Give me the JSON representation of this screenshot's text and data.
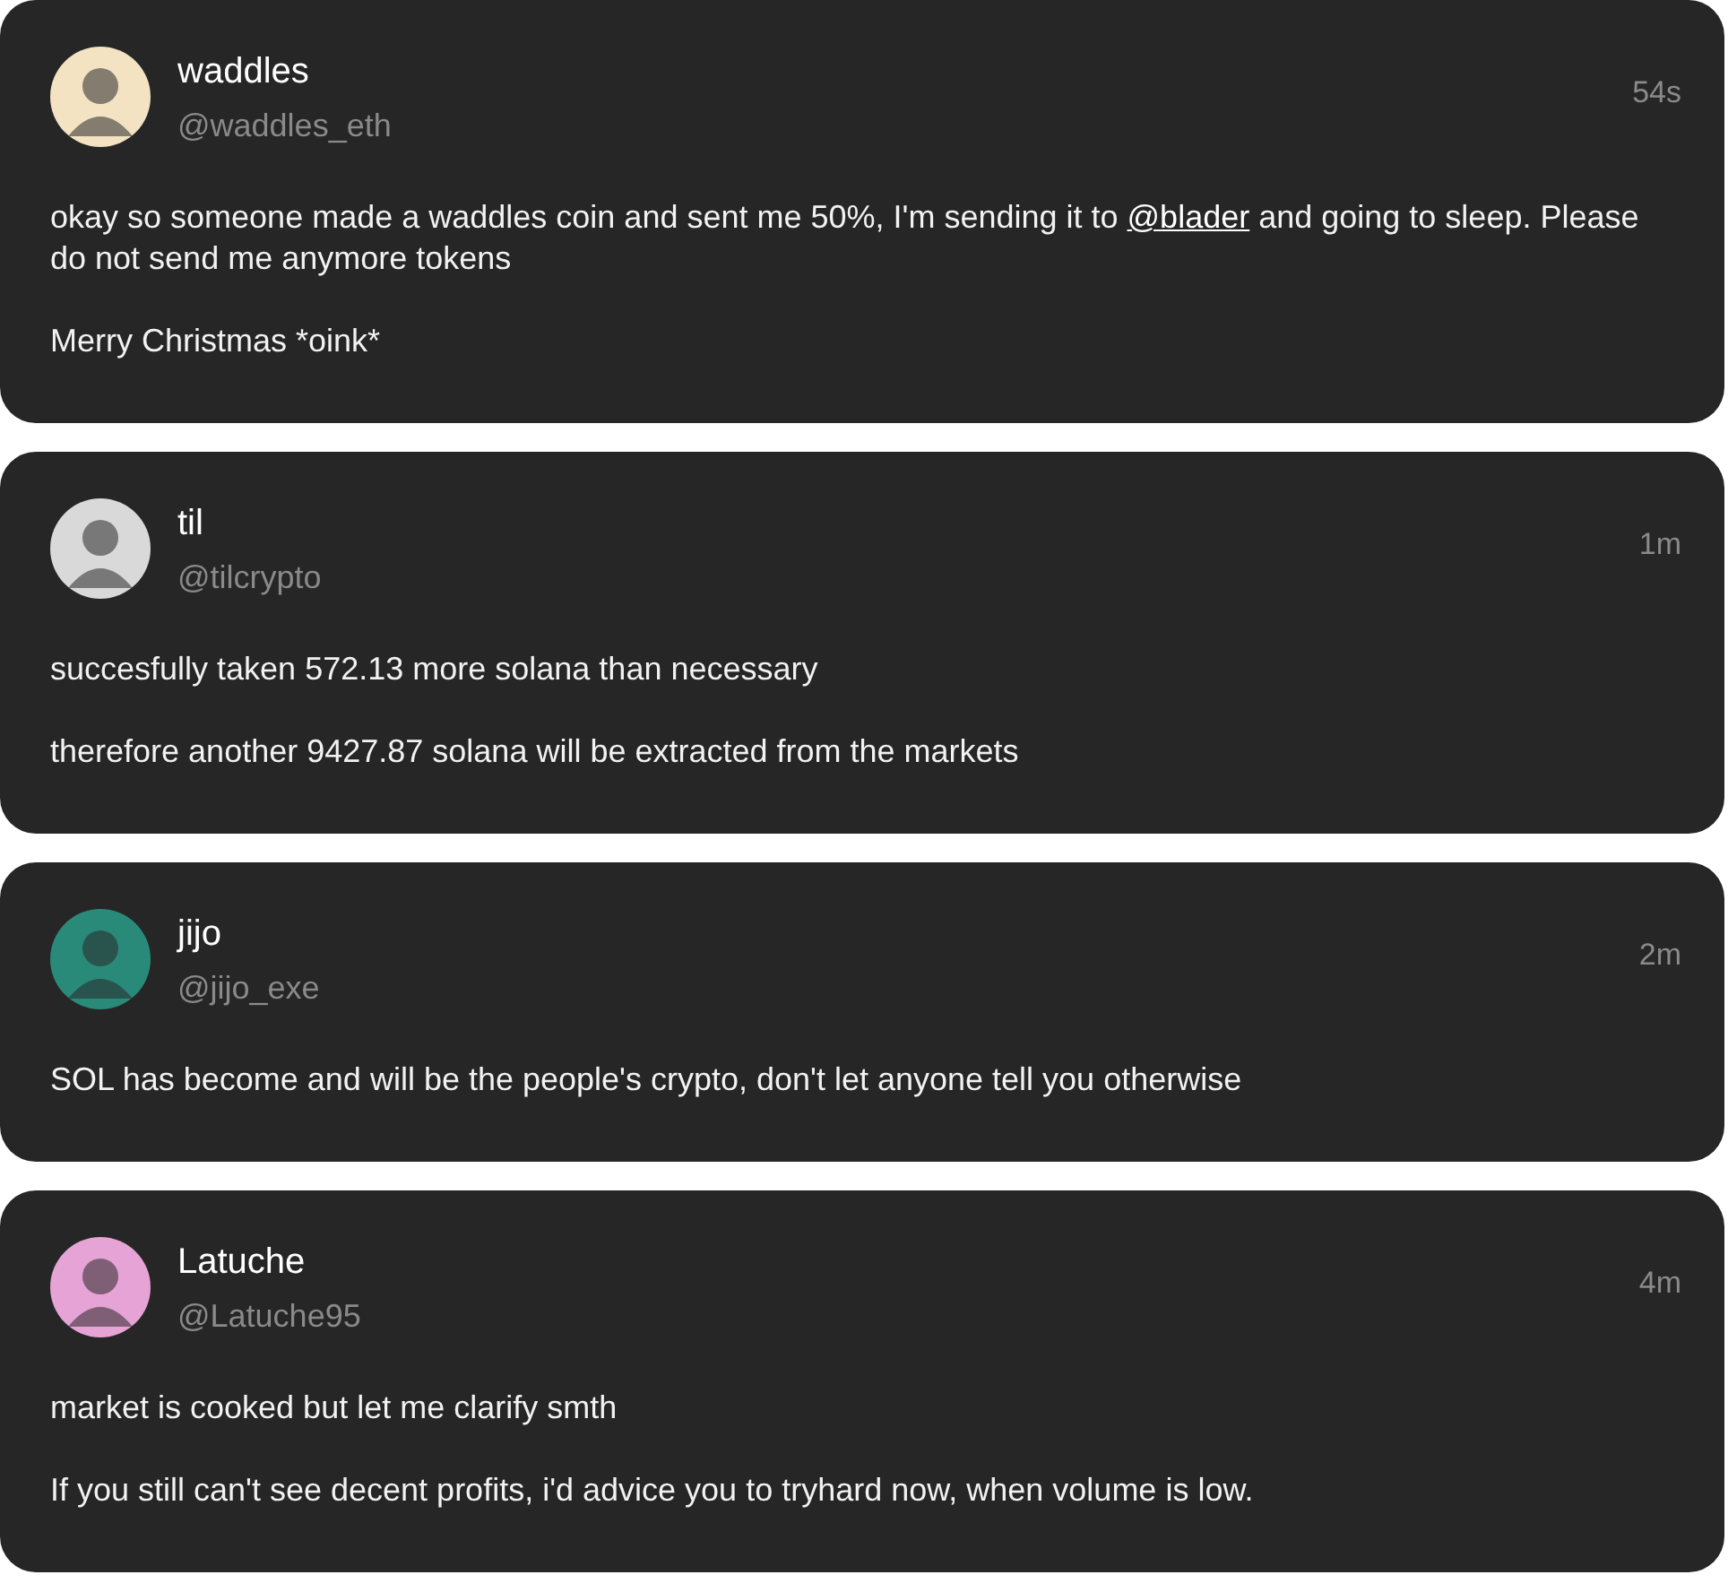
{
  "posts": [
    {
      "name": "waddles",
      "handle": "@waddles_eth",
      "time": "54s",
      "color": "#f3e3c3",
      "paragraphs": [
        [
          {
            "kind": "text",
            "text": "okay so someone made a waddles coin and sent me 50%, I'm sending it to "
          },
          {
            "kind": "mention",
            "text": "@blader"
          },
          {
            "kind": "text",
            "text": " and going to sleep. Please do not send me anymore tokens"
          }
        ],
        [
          {
            "kind": "text",
            "text": "Merry Christmas *oink*"
          }
        ]
      ]
    },
    {
      "name": "til",
      "handle": "@tilcrypto",
      "time": "1m",
      "color": "#d9d9d9",
      "paragraphs": [
        [
          {
            "kind": "text",
            "text": "succesfully taken 572.13 more solana than necessary"
          }
        ],
        [
          {
            "kind": "text",
            "text": "therefore another 9427.87 solana will be extracted from the markets"
          }
        ]
      ]
    },
    {
      "name": "jijo",
      "handle": "@jijo_exe",
      "time": "2m",
      "color": "#2a8a7a",
      "paragraphs": [
        [
          {
            "kind": "text",
            "text": "SOL has become and will be the people's crypto, don't let anyone tell you otherwise"
          }
        ]
      ]
    },
    {
      "name": "Latuche",
      "handle": "@Latuche95",
      "time": "4m",
      "color": "#e6a3d6",
      "paragraphs": [
        [
          {
            "kind": "text",
            "text": "market is cooked but let me clarify smth"
          }
        ],
        [
          {
            "kind": "text",
            "text": "If you still can't see decent profits, i'd advice you to tryhard now, when volume is low."
          }
        ]
      ]
    }
  ]
}
